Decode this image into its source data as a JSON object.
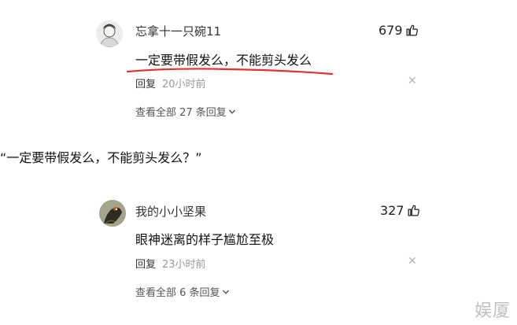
{
  "comments": [
    {
      "username": "忘拿十一只碗11",
      "likes": "679",
      "text": "一定要带假发么，不能剪头发么",
      "reply_label": "回复",
      "time": "20小时前",
      "view_all": "查看全部 27 条回复"
    },
    {
      "username": "我的小小坚果",
      "likes": "327",
      "text": "眼神迷离的样子尴尬至极",
      "reply_label": "回复",
      "time": "23小时前",
      "view_all": "查看全部 6 条回复"
    }
  ],
  "quote": "“一定要带假发么，不能剪头发么？”",
  "watermark": "娱厦",
  "colors": {
    "underline": "#e0332f",
    "muted": "#9a9a9a"
  },
  "icons": {
    "like": "thumbs-up-icon",
    "close": "close-icon",
    "expand": "chevron-down-icon"
  }
}
